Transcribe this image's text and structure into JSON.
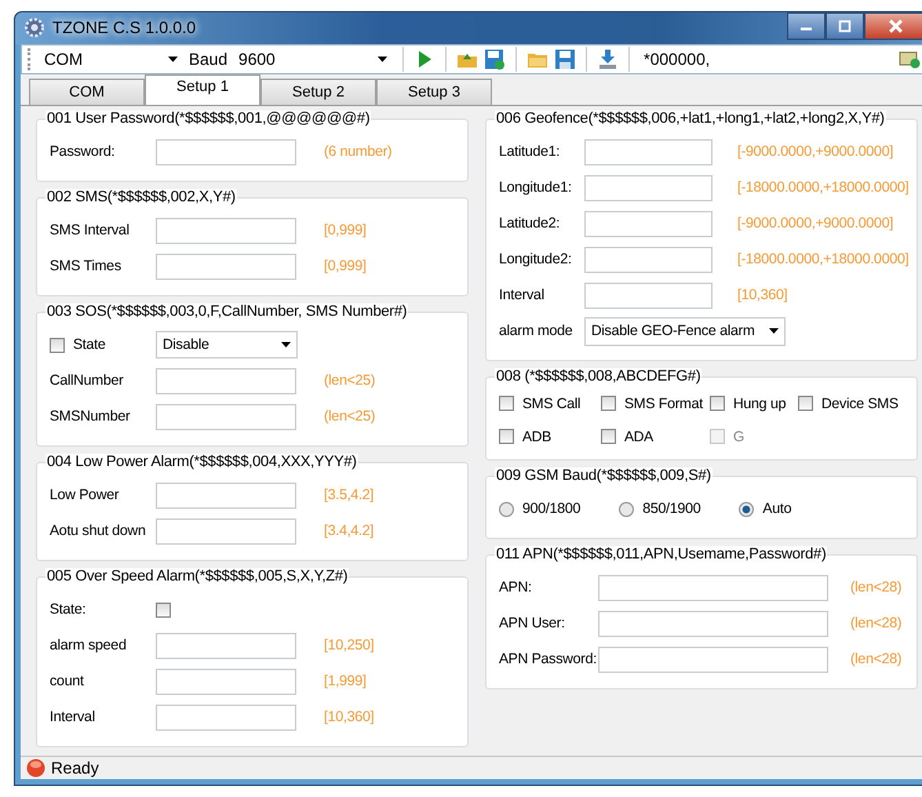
{
  "window": {
    "title": "TZONE C.S 1.0.0.0"
  },
  "toolbar": {
    "port_label": "COM",
    "baud_label": "Baud",
    "baud_value": "9600",
    "command": "*000000,"
  },
  "tabs": [
    {
      "label": "COM",
      "selected": false
    },
    {
      "label": "Setup 1",
      "selected": true
    },
    {
      "label": "Setup 2",
      "selected": false
    },
    {
      "label": "Setup 3",
      "selected": false
    }
  ],
  "left_sections": [
    {
      "title": "001 User Password(*$$$$$$,001,@@@@@@#)",
      "rows": [
        {
          "kind": "field",
          "label": "Password:",
          "hint": "(6 number)"
        }
      ]
    },
    {
      "title": "002 SMS(*$$$$$$,002,X,Y#)",
      "rows": [
        {
          "kind": "field",
          "label": "SMS Interval",
          "hint": "[0,999]"
        },
        {
          "kind": "field",
          "label": "SMS Times",
          "hint": "[0,999]"
        }
      ]
    },
    {
      "title": "003 SOS(*$$$$$$,003,0,F,CallNumber, SMS Number#)",
      "rows": [
        {
          "kind": "checkselect",
          "label": "State",
          "checked": false,
          "value": "Disable"
        },
        {
          "kind": "field",
          "label": "CallNumber",
          "hint": "(len<25)"
        },
        {
          "kind": "field",
          "label": "SMSNumber",
          "hint": "(len<25)"
        }
      ]
    },
    {
      "title": "004 Low Power Alarm(*$$$$$$,004,XXX,YYY#)",
      "rows": [
        {
          "kind": "field",
          "label": "Low Power",
          "hint": "[3.5,4.2]"
        },
        {
          "kind": "field",
          "label": "Aotu shut down",
          "hint": "[3.4,4.2]"
        }
      ]
    },
    {
      "title": "005 Over Speed Alarm(*$$$$$$,005,S,X,Y,Z#)",
      "rows": [
        {
          "kind": "check",
          "label": "State:",
          "checked": false
        },
        {
          "kind": "field",
          "label": "alarm speed",
          "hint": "[10,250]"
        },
        {
          "kind": "field",
          "label": "count",
          "hint": "[1,999]"
        },
        {
          "kind": "field",
          "label": "Interval",
          "hint": "[10,360]"
        }
      ]
    }
  ],
  "right_sections": [
    {
      "title": "006 Geofence(*$$$$$$,006,+lat1,+long1,+lat2,+long2,X,Y#)",
      "rows": [
        {
          "kind": "field",
          "label": "Latitude1:",
          "hint": "[-9000.0000,+9000.0000]"
        },
        {
          "kind": "field",
          "label": "Longitude1:",
          "hint": "[-18000.0000,+18000.0000]"
        },
        {
          "kind": "field",
          "label": "Latitude2:",
          "hint": "[-9000.0000,+9000.0000]"
        },
        {
          "kind": "field",
          "label": "Longitude2:",
          "hint": "[-18000.0000,+18000.0000]"
        },
        {
          "kind": "field",
          "label": "Interval",
          "hint": "[10,360]"
        },
        {
          "kind": "select",
          "label": "alarm mode",
          "value": "Disable GEO-Fence alarm"
        }
      ]
    },
    {
      "title": "008 (*$$$$$$,008,ABCDEFG#)",
      "rows": [
        {
          "kind": "checks",
          "items": [
            {
              "label": "SMS Call",
              "checked": false,
              "disabled": false
            },
            {
              "label": "SMS Format",
              "checked": false,
              "disabled": false
            },
            {
              "label": "Hung up",
              "checked": false,
              "disabled": false
            },
            {
              "label": "Device SMS",
              "checked": false,
              "disabled": false
            },
            {
              "label": "ADB",
              "checked": false,
              "disabled": false
            },
            {
              "label": "ADA",
              "checked": false,
              "disabled": false
            },
            {
              "label": "G",
              "checked": false,
              "disabled": true
            }
          ]
        }
      ]
    },
    {
      "title": "009 GSM Baud(*$$$$$$,009,S#)",
      "rows": [
        {
          "kind": "radios",
          "items": [
            {
              "label": "900/1800",
              "selected": false
            },
            {
              "label": "850/1900",
              "selected": false
            },
            {
              "label": "Auto",
              "selected": true
            }
          ]
        }
      ]
    },
    {
      "title": "011 APN(*$$$$$$,011,APN,Usemame,Password#)",
      "rows": [
        {
          "kind": "widefield",
          "label": "APN:",
          "hint": "(len<28)"
        },
        {
          "kind": "widefield",
          "label": "APN User:",
          "hint": "(len<28)"
        },
        {
          "kind": "widefield",
          "label": "APN Password:",
          "hint": "(len<28)"
        }
      ]
    }
  ],
  "status_bar": {
    "text": "Ready"
  }
}
